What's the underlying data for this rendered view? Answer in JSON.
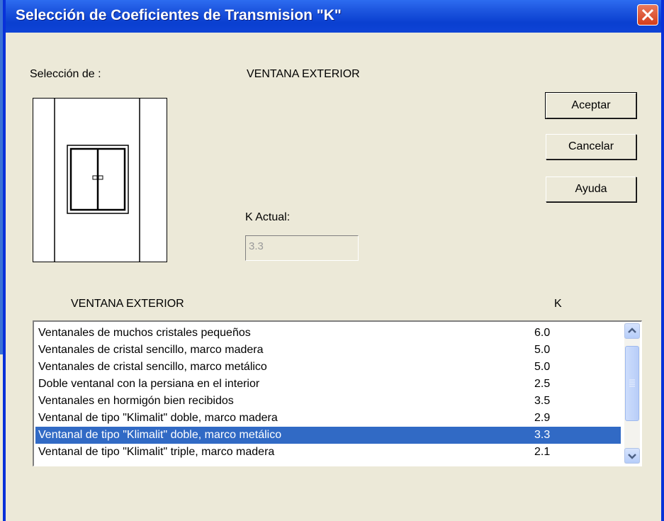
{
  "dialog": {
    "title": "Selección de Coeficientes de Transmision \"K\""
  },
  "selection": {
    "label": "Selección de :",
    "value": "VENTANA EXTERIOR"
  },
  "buttons": {
    "accept": "Aceptar",
    "cancel": "Cancelar",
    "help": "Ayuda"
  },
  "k_actual": {
    "label": "K Actual:",
    "value": "3.3"
  },
  "list": {
    "header_name": "VENTANA EXTERIOR",
    "header_k": "K",
    "rows": [
      {
        "name": "Ventanales de muchos cristales pequeños",
        "k": "6.0"
      },
      {
        "name": "Ventanales de cristal sencillo, marco madera",
        "k": "5.0"
      },
      {
        "name": "Ventanales de cristal sencillo, marco metálico",
        "k": "5.0"
      },
      {
        "name": "Doble ventanal con la persiana en el interior",
        "k": "2.5"
      },
      {
        "name": "Ventanales en hormigón bien recibidos",
        "k": "3.5"
      },
      {
        "name": "Ventanal de tipo \"Klimalit\" doble, marco madera",
        "k": "2.9"
      },
      {
        "name": "Ventanal de tipo \"Klimalit\" doble, marco metálico",
        "k": "3.3"
      },
      {
        "name": "Ventanal de tipo \"Klimalit\" triple, marco madera",
        "k": "2.1"
      }
    ],
    "selected_index": 6
  },
  "icons": {
    "close": "close-icon",
    "window_preview": "window-preview-icon",
    "scroll_up": "chevron-up-icon",
    "scroll_down": "chevron-down-icon",
    "scroll_grip": "grip-icon"
  },
  "colors": {
    "titlebar": "#0a3fd0",
    "selection": "#316ac5",
    "face": "#ece9d8"
  }
}
